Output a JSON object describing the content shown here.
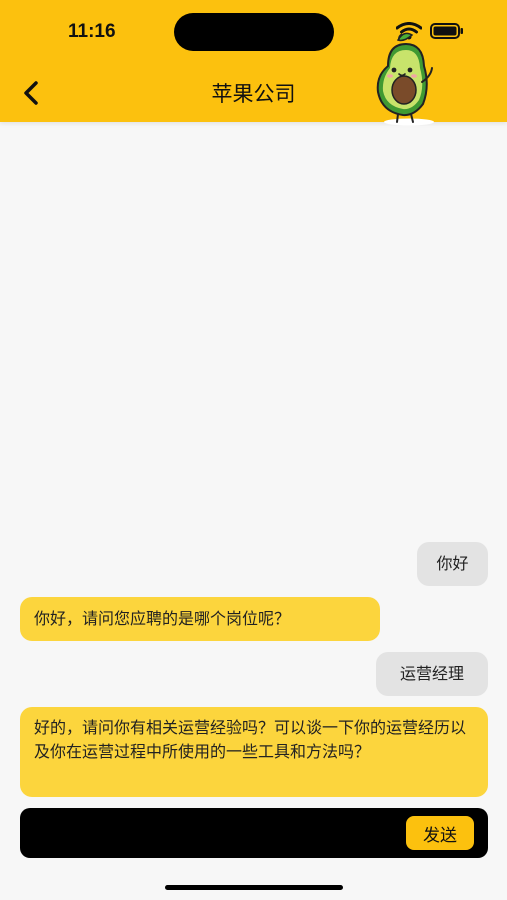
{
  "status_bar": {
    "time": "11:16"
  },
  "header": {
    "title": "苹果公司",
    "back_icon": "chevron-left-icon",
    "mascot": "avocado-mascot-icon"
  },
  "messages": [
    {
      "role": "user",
      "text": "你好"
    },
    {
      "role": "bot",
      "text": "你好，请问您应聘的是哪个岗位呢？"
    },
    {
      "role": "user",
      "text": "运营经理"
    },
    {
      "role": "bot",
      "text": "好的，请问你有相关运营经验吗？可以谈一下你的运营经历以及你在运营过程中所使用的一些工具和方法吗？"
    }
  ],
  "composer": {
    "value": "",
    "send_label": "发送"
  },
  "colors": {
    "accent": "#fcc10e",
    "bot_bubble": "#fcd53d",
    "user_bubble": "#e3e3e3"
  }
}
